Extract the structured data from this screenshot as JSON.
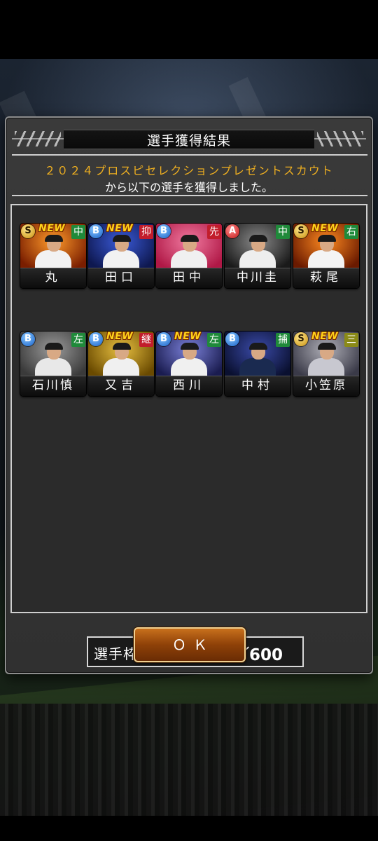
{
  "dialog": {
    "title": "選手獲得結果",
    "message_line1": "２０２４プロスピセレクションプレゼントスカウト",
    "message_line2": "から以下の選手を獲得しました。",
    "new_label": "NEW",
    "players": [
      {
        "name": "丸",
        "rank": "S",
        "position": "中",
        "new": true,
        "position_color": "#1f8a3a"
      },
      {
        "name": "田口",
        "rank": "B",
        "position": "抑",
        "new": true,
        "position_color": "#c21d2b"
      },
      {
        "name": "田中",
        "rank": "B",
        "position": "先",
        "new": false,
        "position_color": "#c21d2b"
      },
      {
        "name": "中川圭",
        "rank": "A",
        "position": "中",
        "new": false,
        "position_color": "#1f8a3a"
      },
      {
        "name": "萩尾",
        "rank": "S",
        "position": "右",
        "new": true,
        "position_color": "#1f8a3a"
      },
      {
        "name": "石川慎",
        "rank": "B",
        "position": "左",
        "new": false,
        "position_color": "#1f8a3a"
      },
      {
        "name": "又吉",
        "rank": "B",
        "position": "継",
        "new": true,
        "position_color": "#c21d2b"
      },
      {
        "name": "西川",
        "rank": "B",
        "position": "左",
        "new": true,
        "position_color": "#1f8a3a"
      },
      {
        "name": "中村",
        "rank": "B",
        "position": "捕",
        "new": false,
        "position_color": "#1f8a3a"
      },
      {
        "name": "小笠原",
        "rank": "S",
        "position": "三",
        "new": true,
        "position_color": "#8a8a18"
      }
    ],
    "slots_label": "選手枠：",
    "slots_value": "530／600",
    "ok_label": "ＯＫ"
  },
  "colors": {
    "accent_orange": "#f0b020",
    "ok_button": "#8e4108"
  }
}
